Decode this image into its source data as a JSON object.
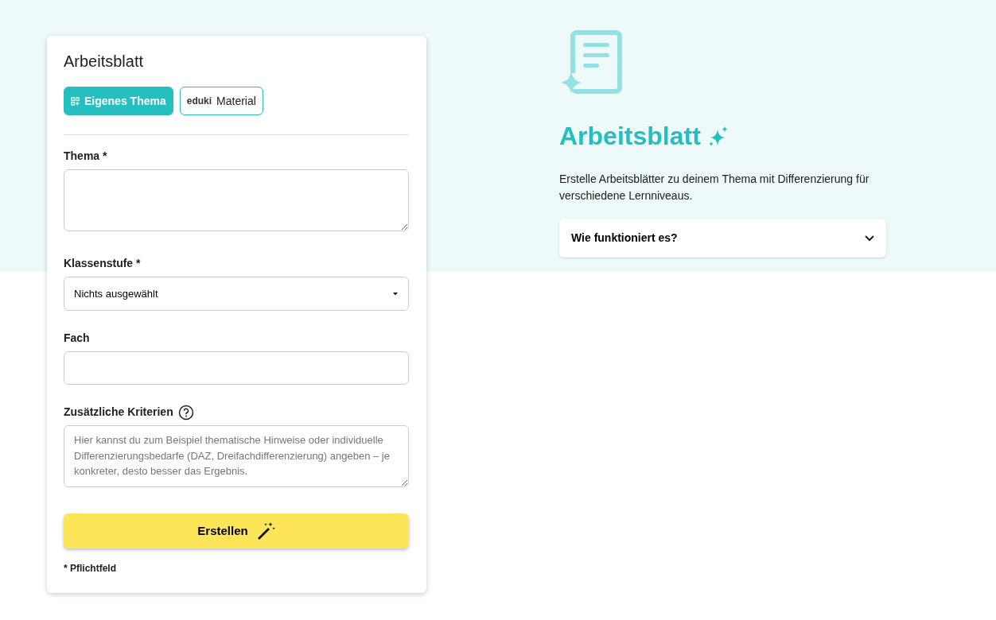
{
  "form": {
    "title": "Arbeitsblatt",
    "tabs": [
      {
        "kind": "icon",
        "label": "Eigenes Thema",
        "selected": true
      },
      {
        "kind": "logo",
        "logo": "eduki",
        "label": "Material",
        "selected": false
      }
    ],
    "fields": [
      {
        "kind": "textarea",
        "label": "Thema *"
      },
      {
        "kind": "select",
        "label": "Klassenstufe *",
        "value": "Nichts ausgewählt"
      },
      {
        "kind": "input",
        "label": "Fach"
      },
      {
        "kind": "textarea",
        "label": "Zusätzliche Kriterien",
        "help": true,
        "placeholder": "Hier kannst du zum Beispiel thematische Hinweise oder individuelle Differenzierungsbedarfe (DAZ, Dreifachdifferenzierung) angeben – je konkreter, desto besser das Ergebnis."
      }
    ],
    "submit": "Erstellen",
    "footnote": "* Pflichtfeld"
  },
  "info": {
    "title": "Arbeitsblatt",
    "description": "Erstelle Arbeitsblätter zu deinem Thema mit Differenzierung für verschiedene Lernniveaus.",
    "accordion": {
      "label": "Wie funktioniert es?",
      "expanded": false
    }
  }
}
